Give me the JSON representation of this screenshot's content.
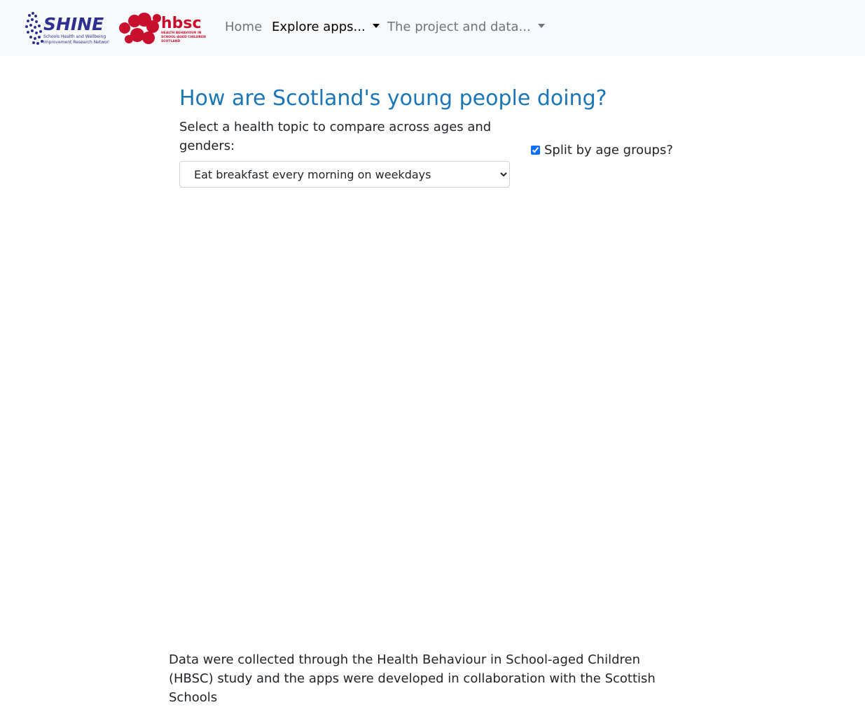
{
  "navbar": {
    "logo_shine_text": "SHINE",
    "logo_shine_subtitle": "Schools Health and Wellbeing Improvement Research Network",
    "logo_hbsc_text": "hbsc",
    "logo_hbsc_subtitle": "HEALTH BEHAVIOUR IN SCHOOL-AGED CHILDREN SCOTLAND",
    "links": [
      {
        "label": "Home"
      },
      {
        "label": "Explore apps..."
      },
      {
        "label": "The project and data..."
      }
    ]
  },
  "main": {
    "title": "How are Scotland's young people doing?",
    "select_label": "Select a health topic to compare across ages and genders:",
    "topic_select": {
      "selected": "Eat breakfast every morning on weekdays"
    },
    "split_checkbox": {
      "label": "Split by age groups?",
      "checked": true
    }
  },
  "footer": {
    "text": "Data were collected through the Health Behaviour in School-aged Children (HBSC) study and the apps were developed in collaboration with the Scottish Schools"
  },
  "colors": {
    "title": "#1a76b5",
    "shine_blue": "#2e3192",
    "hbsc_red": "#c8102e",
    "navbar_bg": "#f8f9fa"
  }
}
